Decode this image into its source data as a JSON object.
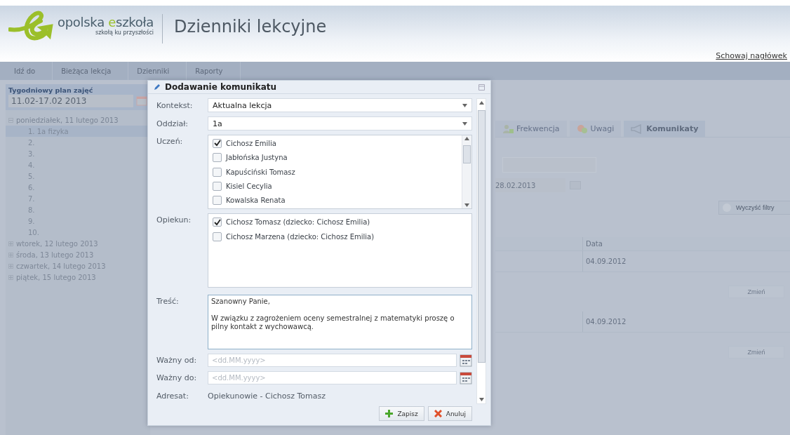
{
  "header": {
    "logo": {
      "part_1": "opolska ",
      "part_2": "e",
      "part_3": "szkoła",
      "tagline": "szkołą ku przyszłości"
    },
    "app_title": "Dzienniki lekcyjne",
    "hide_header_link": "Schowaj nagłówek"
  },
  "nav": [
    "Idź do",
    "Bieżąca lekcja",
    "Dzienniki",
    "Raporty"
  ],
  "sidebar": {
    "title": "Tygodniowy plan zajęć",
    "week": "11.02-17.02 2013",
    "days": [
      {
        "label": "poniedziałek, 11 lutego 2013",
        "expanded": true,
        "children": [
          {
            "label": "1. 1a   fizyka",
            "selected": true
          },
          {
            "label": "2.",
            "selected": false
          },
          {
            "label": "3.",
            "selected": false
          },
          {
            "label": "4.",
            "selected": false
          },
          {
            "label": "5.",
            "selected": false
          },
          {
            "label": "6.",
            "selected": false
          },
          {
            "label": "7.",
            "selected": false
          },
          {
            "label": "8.",
            "selected": false
          },
          {
            "label": "9.",
            "selected": false
          },
          {
            "label": "10.",
            "selected": false
          }
        ]
      },
      {
        "label": "wtorek, 12 lutego 2013",
        "expanded": false
      },
      {
        "label": "środa, 13 lutego 2013",
        "expanded": false
      },
      {
        "label": "czwartek, 14 lutego 2013",
        "expanded": false
      },
      {
        "label": "piątek, 15 lutego 2013",
        "expanded": false
      }
    ]
  },
  "main": {
    "tabs": [
      {
        "label": "Frekwencja",
        "selected": false
      },
      {
        "label": "Uwagi",
        "selected": false
      },
      {
        "label": "Komunikaty",
        "selected": true
      }
    ],
    "date_to": "28.02.2013",
    "clear_filters_button": "Wyczyść filtry",
    "table": {
      "column": "Data",
      "rows": [
        {
          "date": "04.09.2012",
          "button": "Zmień"
        },
        {
          "date": "04.09.2012",
          "button": "Zmień"
        }
      ]
    }
  },
  "dialog": {
    "title": "Dodawanie komunikatu",
    "context": {
      "label": "Kontekst:",
      "value": "Aktualna lekcja"
    },
    "class": {
      "label": "Oddział:",
      "value": "1a"
    },
    "students": {
      "label": "Uczeń:",
      "items": [
        {
          "name": "Cichosz Emilia",
          "checked": true
        },
        {
          "name": "Jabłońska Justyna",
          "checked": false
        },
        {
          "name": "Kapuściński Tomasz",
          "checked": false
        },
        {
          "name": "Kisiel Cecylia",
          "checked": false
        },
        {
          "name": "Kowalska Renata",
          "checked": false
        }
      ]
    },
    "guardians": {
      "label": "Opiekun:",
      "items": [
        {
          "name": "Cichosz Tomasz (dziecko: Cichosz Emilia)",
          "checked": true
        },
        {
          "name": "Cichosz Marzena (dziecko: Cichosz Emilia)",
          "checked": false
        }
      ]
    },
    "content": {
      "label": "Treść:",
      "value": "Szanowny Panie,\n\nW związku z zagrożeniem oceny semestralnej z matematyki proszę o pilny kontakt z wychowawcą."
    },
    "valid_from": {
      "label": "Ważny od:",
      "placeholder": "<dd.MM.yyyy>"
    },
    "valid_to": {
      "label": "Ważny do:",
      "placeholder": "<dd.MM.yyyy>"
    },
    "recipient": {
      "label": "Adresat:",
      "value": "Opiekunowie - Cichosz Tomasz"
    },
    "buttons": [
      {
        "kind": "save",
        "label": "Zapisz"
      },
      {
        "kind": "cancel",
        "label": "Anuluj"
      }
    ]
  }
}
